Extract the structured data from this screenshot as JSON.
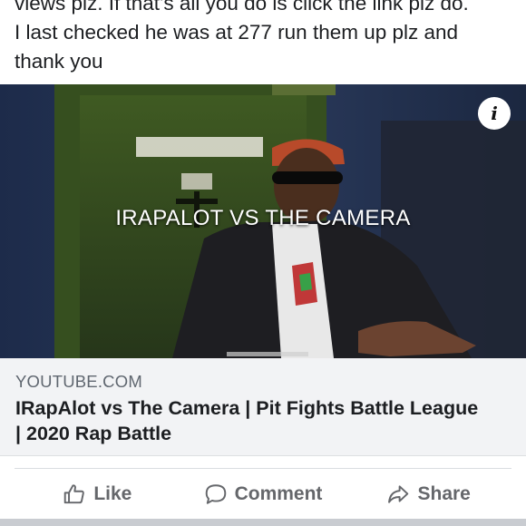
{
  "post": {
    "text_lines": [
      "views plz. If that's all you do is click the link plz do.",
      "I last checked he was at 277 run them up plz and",
      "thank you"
    ]
  },
  "media": {
    "overlay_title": "IRAPALOT VS THE CAMERA",
    "info_icon": "info-icon",
    "info_glyph": "i"
  },
  "link_preview": {
    "domain": "YOUTUBE.COM",
    "title_lines": [
      "IRapAlot vs The Camera | Pit Fights Battle League",
      "| 2020 Rap Battle"
    ]
  },
  "actions": {
    "like_label": "Like",
    "comment_label": "Comment",
    "share_label": "Share",
    "icon_color": "#65676b"
  }
}
